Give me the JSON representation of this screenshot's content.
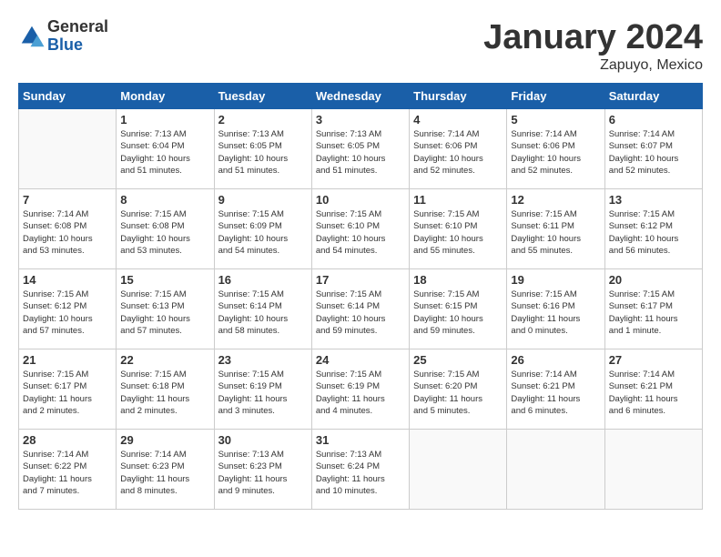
{
  "header": {
    "logo_general": "General",
    "logo_blue": "Blue",
    "title": "January 2024",
    "location": "Zapuyo, Mexico"
  },
  "calendar": {
    "days_of_week": [
      "Sunday",
      "Monday",
      "Tuesday",
      "Wednesday",
      "Thursday",
      "Friday",
      "Saturday"
    ],
    "weeks": [
      [
        {
          "day": "",
          "info": ""
        },
        {
          "day": "1",
          "info": "Sunrise: 7:13 AM\nSunset: 6:04 PM\nDaylight: 10 hours\nand 51 minutes."
        },
        {
          "day": "2",
          "info": "Sunrise: 7:13 AM\nSunset: 6:05 PM\nDaylight: 10 hours\nand 51 minutes."
        },
        {
          "day": "3",
          "info": "Sunrise: 7:13 AM\nSunset: 6:05 PM\nDaylight: 10 hours\nand 51 minutes."
        },
        {
          "day": "4",
          "info": "Sunrise: 7:14 AM\nSunset: 6:06 PM\nDaylight: 10 hours\nand 52 minutes."
        },
        {
          "day": "5",
          "info": "Sunrise: 7:14 AM\nSunset: 6:06 PM\nDaylight: 10 hours\nand 52 minutes."
        },
        {
          "day": "6",
          "info": "Sunrise: 7:14 AM\nSunset: 6:07 PM\nDaylight: 10 hours\nand 52 minutes."
        }
      ],
      [
        {
          "day": "7",
          "info": "Sunrise: 7:14 AM\nSunset: 6:08 PM\nDaylight: 10 hours\nand 53 minutes."
        },
        {
          "day": "8",
          "info": "Sunrise: 7:15 AM\nSunset: 6:08 PM\nDaylight: 10 hours\nand 53 minutes."
        },
        {
          "day": "9",
          "info": "Sunrise: 7:15 AM\nSunset: 6:09 PM\nDaylight: 10 hours\nand 54 minutes."
        },
        {
          "day": "10",
          "info": "Sunrise: 7:15 AM\nSunset: 6:10 PM\nDaylight: 10 hours\nand 54 minutes."
        },
        {
          "day": "11",
          "info": "Sunrise: 7:15 AM\nSunset: 6:10 PM\nDaylight: 10 hours\nand 55 minutes."
        },
        {
          "day": "12",
          "info": "Sunrise: 7:15 AM\nSunset: 6:11 PM\nDaylight: 10 hours\nand 55 minutes."
        },
        {
          "day": "13",
          "info": "Sunrise: 7:15 AM\nSunset: 6:12 PM\nDaylight: 10 hours\nand 56 minutes."
        }
      ],
      [
        {
          "day": "14",
          "info": "Sunrise: 7:15 AM\nSunset: 6:12 PM\nDaylight: 10 hours\nand 57 minutes."
        },
        {
          "day": "15",
          "info": "Sunrise: 7:15 AM\nSunset: 6:13 PM\nDaylight: 10 hours\nand 57 minutes."
        },
        {
          "day": "16",
          "info": "Sunrise: 7:15 AM\nSunset: 6:14 PM\nDaylight: 10 hours\nand 58 minutes."
        },
        {
          "day": "17",
          "info": "Sunrise: 7:15 AM\nSunset: 6:14 PM\nDaylight: 10 hours\nand 59 minutes."
        },
        {
          "day": "18",
          "info": "Sunrise: 7:15 AM\nSunset: 6:15 PM\nDaylight: 10 hours\nand 59 minutes."
        },
        {
          "day": "19",
          "info": "Sunrise: 7:15 AM\nSunset: 6:16 PM\nDaylight: 11 hours\nand 0 minutes."
        },
        {
          "day": "20",
          "info": "Sunrise: 7:15 AM\nSunset: 6:17 PM\nDaylight: 11 hours\nand 1 minute."
        }
      ],
      [
        {
          "day": "21",
          "info": "Sunrise: 7:15 AM\nSunset: 6:17 PM\nDaylight: 11 hours\nand 2 minutes."
        },
        {
          "day": "22",
          "info": "Sunrise: 7:15 AM\nSunset: 6:18 PM\nDaylight: 11 hours\nand 2 minutes."
        },
        {
          "day": "23",
          "info": "Sunrise: 7:15 AM\nSunset: 6:19 PM\nDaylight: 11 hours\nand 3 minutes."
        },
        {
          "day": "24",
          "info": "Sunrise: 7:15 AM\nSunset: 6:19 PM\nDaylight: 11 hours\nand 4 minutes."
        },
        {
          "day": "25",
          "info": "Sunrise: 7:15 AM\nSunset: 6:20 PM\nDaylight: 11 hours\nand 5 minutes."
        },
        {
          "day": "26",
          "info": "Sunrise: 7:14 AM\nSunset: 6:21 PM\nDaylight: 11 hours\nand 6 minutes."
        },
        {
          "day": "27",
          "info": "Sunrise: 7:14 AM\nSunset: 6:21 PM\nDaylight: 11 hours\nand 6 minutes."
        }
      ],
      [
        {
          "day": "28",
          "info": "Sunrise: 7:14 AM\nSunset: 6:22 PM\nDaylight: 11 hours\nand 7 minutes."
        },
        {
          "day": "29",
          "info": "Sunrise: 7:14 AM\nSunset: 6:23 PM\nDaylight: 11 hours\nand 8 minutes."
        },
        {
          "day": "30",
          "info": "Sunrise: 7:13 AM\nSunset: 6:23 PM\nDaylight: 11 hours\nand 9 minutes."
        },
        {
          "day": "31",
          "info": "Sunrise: 7:13 AM\nSunset: 6:24 PM\nDaylight: 11 hours\nand 10 minutes."
        },
        {
          "day": "",
          "info": ""
        },
        {
          "day": "",
          "info": ""
        },
        {
          "day": "",
          "info": ""
        }
      ]
    ]
  }
}
